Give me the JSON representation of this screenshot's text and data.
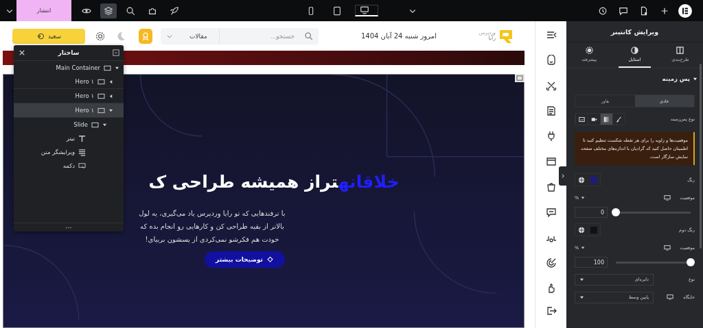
{
  "topbar": {
    "publish_button": "انتشار",
    "devices": [
      {
        "kind": "mobile",
        "selected": false
      },
      {
        "kind": "tablet",
        "selected": false
      },
      {
        "kind": "desktop",
        "selected": true
      }
    ]
  },
  "site_header": {
    "logo": {
      "top": "وردپرس",
      "bottom": "رایا"
    },
    "date": "امروز شنبه 24 آبان 1404",
    "search": {
      "placeholder": "جستجو..."
    },
    "category": "مقالات",
    "login_button": "سعید"
  },
  "navigator": {
    "title": "ساختار",
    "items": [
      {
        "label": "Main Container",
        "kind": "container",
        "expanded": true,
        "selected": false,
        "children": [
          {
            "label": "Hero ۱",
            "kind": "container",
            "expanded": false,
            "selected": false
          },
          {
            "label": "Hero ۱",
            "kind": "container",
            "expanded": false,
            "selected": false
          },
          {
            "label": "Hero ۱",
            "kind": "container",
            "expanded": true,
            "selected": true,
            "children": [
              {
                "label": "Slide",
                "kind": "container",
                "expanded": true,
                "selected": false,
                "children": [
                  {
                    "label": "تیتر",
                    "kind": "heading",
                    "selected": false
                  },
                  {
                    "label": "ویرایشگر متن",
                    "kind": "text",
                    "selected": false
                  },
                  {
                    "label": "دکمه",
                    "kind": "button",
                    "selected": false
                  }
                ]
              }
            ]
          }
        ]
      }
    ]
  },
  "hero": {
    "headline_highlight": "خلاقانه",
    "headline": "تراز همیشه طراحی ک",
    "paragraph": "با ترفندهایی که تو رایا وردپرس یاد می‌گیری، یه لول بالاتر از بقیه طراحی کن و کارهایی رو انجام بده که خودت هم فکرشو نمی‌کردی از پسشون بربیای!",
    "button": "توضیحات بیشتر"
  },
  "panel": {
    "title": "ویرایش کانتینر",
    "tabs": [
      {
        "label": "طرح‌بندی",
        "kind": "layout",
        "selected": false
      },
      {
        "label": "استایل",
        "kind": "style",
        "selected": true
      },
      {
        "label": "پیشرفته",
        "kind": "advanced",
        "selected": false
      }
    ],
    "section": {
      "title": "پس زمینه",
      "expanded": true
    },
    "states": [
      {
        "label": "عادی",
        "selected": true
      },
      {
        "label": "هاور",
        "selected": false
      }
    ],
    "background_type": {
      "label": "نوع پس‌زمینه",
      "options": [
        {
          "kind": "classic",
          "selected": false
        },
        {
          "kind": "gradient",
          "selected": true
        },
        {
          "kind": "video",
          "selected": false
        },
        {
          "kind": "slideshow",
          "selected": false
        }
      ]
    },
    "notice": "موقعیت‌ها و زاویه را برای هر نقطه شکست تنظیم کنید تا اطمینان حاصل کنید که گرادیان با اندازه‌های مختلف صفحه نمایش سازگار است.",
    "controls": [
      {
        "kind": "color",
        "label": "رنگ",
        "color": "#1c1c80"
      },
      {
        "kind": "slider",
        "label": "موقعیت",
        "unit": "%",
        "value": "0",
        "level": 0
      },
      {
        "kind": "color",
        "label": "رنگ دوم",
        "color": "#111111"
      },
      {
        "kind": "slider",
        "label": "موقعیت",
        "unit": "%",
        "value": "100",
        "level": 1
      },
      {
        "kind": "select",
        "label": "نوع",
        "value": "دایره‌ای",
        "responsive": false
      },
      {
        "kind": "select",
        "label": "جایگاه",
        "value": "پایین وسط",
        "responsive": true
      }
    ]
  }
}
